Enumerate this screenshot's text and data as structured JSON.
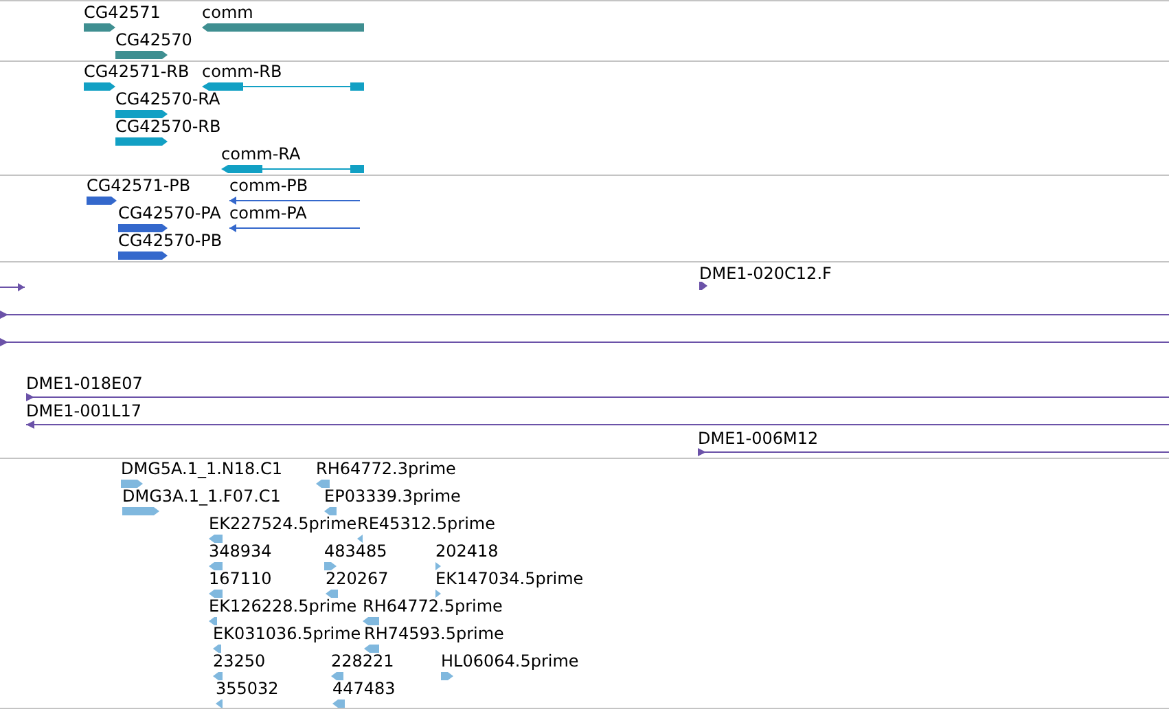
{
  "tracks": [
    {
      "kind": "gene",
      "features": [
        {
          "label": "CG42571",
          "reverse": false
        },
        {
          "label": "comm",
          "reverse": true
        },
        {
          "label": "CG42570",
          "reverse": false
        }
      ]
    },
    {
      "kind": "transcript",
      "features": [
        {
          "label": "CG42571-RB",
          "reverse": false
        },
        {
          "label": "comm-RB",
          "reverse": true
        },
        {
          "label": "CG42570-RA",
          "reverse": false
        },
        {
          "label": "CG42570-RB",
          "reverse": false
        },
        {
          "label": "comm-RA",
          "reverse": true
        }
      ]
    },
    {
      "kind": "protein",
      "features": [
        {
          "label": "CG42571-PB",
          "reverse": false
        },
        {
          "label": "comm-PB",
          "reverse": true
        },
        {
          "label": "CG42570-PA",
          "reverse": false
        },
        {
          "label": "comm-PA",
          "reverse": true
        },
        {
          "label": "CG42570-PB",
          "reverse": false
        }
      ]
    },
    {
      "kind": "clone",
      "features": [
        {
          "reverse": false
        },
        {
          "label": "DME1-020C12.F",
          "reverse": false
        },
        {
          "reverse": false
        },
        {
          "reverse": false
        },
        {
          "label": "DME1-018E07",
          "reverse": false
        },
        {
          "label": "DME1-001L17",
          "reverse": true
        },
        {
          "label": "DME1-006M12",
          "reverse": false
        }
      ]
    },
    {
      "kind": "est",
      "features": [
        {
          "label": "DMG5A.1_1.N18.C1",
          "reverse": false
        },
        {
          "label": "DMG3A.1_1.F07.C1",
          "reverse": false
        },
        {
          "label": "RH64772.3prime",
          "reverse": true
        },
        {
          "label": "EP03339.3prime",
          "reverse": true
        },
        {
          "label": "EK227524.5prime",
          "reverse": true
        },
        {
          "label": "RE45312.5prime",
          "reverse": true
        },
        {
          "label": "348934",
          "reverse": true
        },
        {
          "label": "483485",
          "reverse": false
        },
        {
          "label": "202418",
          "reverse": false
        },
        {
          "label": "167110",
          "reverse": true
        },
        {
          "label": "220267",
          "reverse": true
        },
        {
          "label": "EK147034.5prime",
          "reverse": false
        },
        {
          "label": "EK126228.5prime",
          "reverse": true
        },
        {
          "label": "RH64772.5prime",
          "reverse": true
        },
        {
          "label": "EK031036.5prime",
          "reverse": true
        },
        {
          "label": "RH74593.5prime",
          "reverse": true
        },
        {
          "label": "23250",
          "reverse": true
        },
        {
          "label": "228221",
          "reverse": true
        },
        {
          "label": "HL06064.5prime",
          "reverse": false
        },
        {
          "label": "355032",
          "reverse": true
        },
        {
          "label": "447483",
          "reverse": true
        }
      ]
    }
  ]
}
